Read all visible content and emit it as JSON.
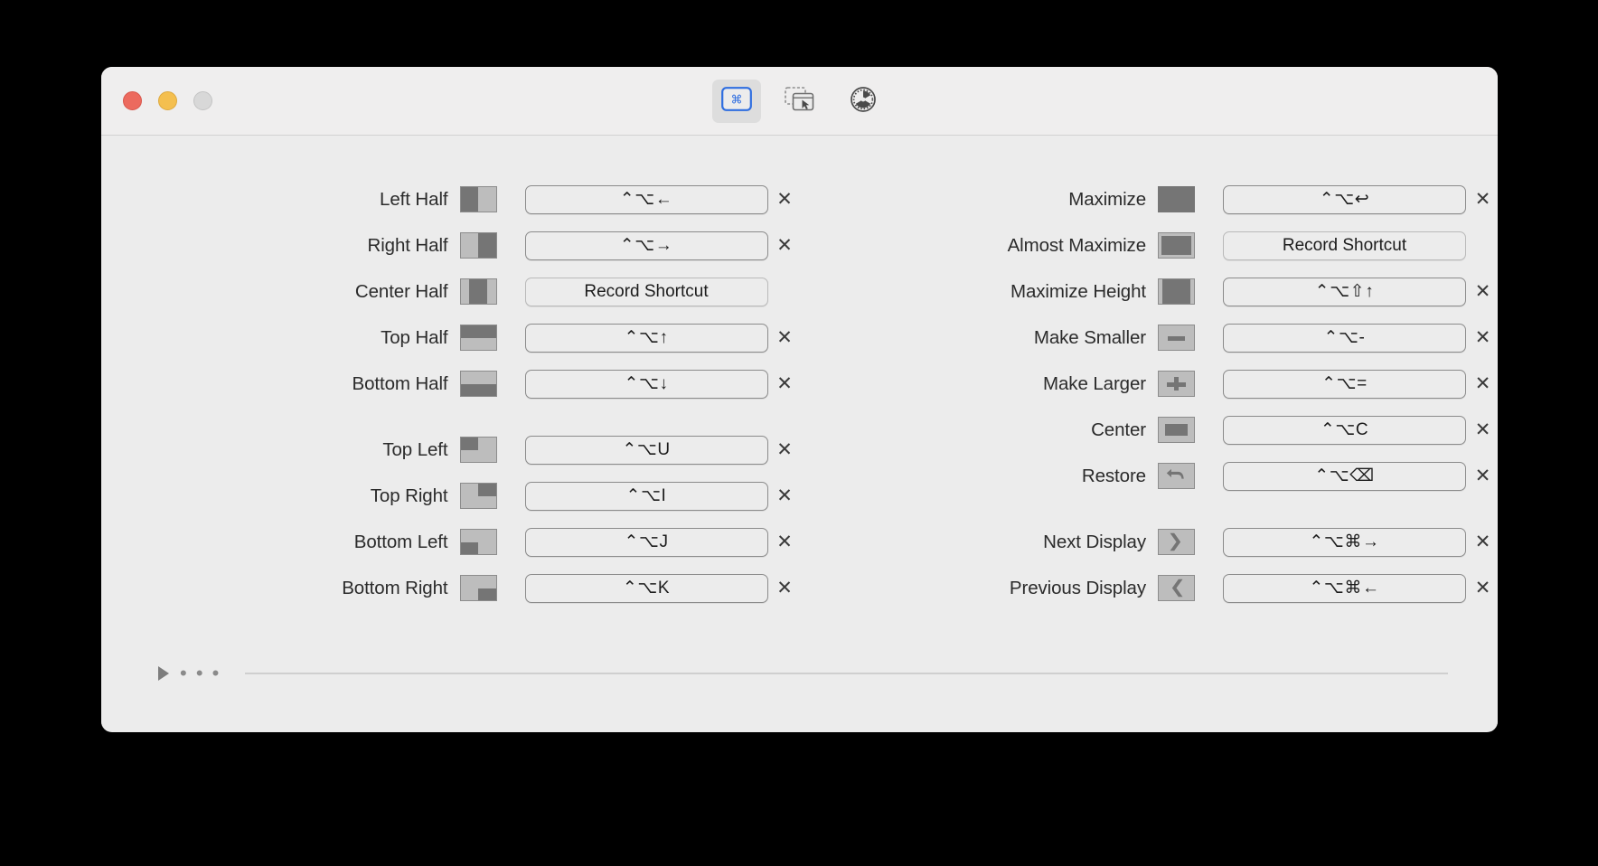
{
  "window": {
    "traffic_lights": [
      {
        "name": "close",
        "color": "#ec6a5e"
      },
      {
        "name": "minimize",
        "color": "#f4bf4f"
      },
      {
        "name": "zoom",
        "color": "#d8d8d8"
      }
    ],
    "accent_color": "#2f6ee0",
    "background": "#ececec"
  },
  "toolbar": {
    "items": [
      {
        "id": "keyboard-shortcuts",
        "icon": "command-window-icon",
        "selected": true
      },
      {
        "id": "snap-areas",
        "icon": "snap-areas-icon",
        "selected": false
      },
      {
        "id": "settings",
        "icon": "gear-icon",
        "selected": false
      }
    ]
  },
  "shortcut_placeholder": "Record Shortcut",
  "clear_glyph": "✕",
  "left_column": [
    {
      "label": "Left Half",
      "icon": "half-left-icon",
      "shortcut": "⌃⌥←",
      "has_shortcut": true,
      "gap_before": false
    },
    {
      "label": "Right Half",
      "icon": "half-right-icon",
      "shortcut": "⌃⌥→",
      "has_shortcut": true,
      "gap_before": false
    },
    {
      "label": "Center Half",
      "icon": "half-center-icon",
      "shortcut": "Record Shortcut",
      "has_shortcut": false,
      "gap_before": false
    },
    {
      "label": "Top Half",
      "icon": "half-top-icon",
      "shortcut": "⌃⌥↑",
      "has_shortcut": true,
      "gap_before": false
    },
    {
      "label": "Bottom Half",
      "icon": "half-bottom-icon",
      "shortcut": "⌃⌥↓",
      "has_shortcut": true,
      "gap_before": false
    },
    {
      "label": "Top Left",
      "icon": "quadrant-top-left-icon",
      "shortcut": "⌃⌥U",
      "has_shortcut": true,
      "gap_before": true
    },
    {
      "label": "Top Right",
      "icon": "quadrant-top-right-icon",
      "shortcut": "⌃⌥I",
      "has_shortcut": true,
      "gap_before": false
    },
    {
      "label": "Bottom Left",
      "icon": "quadrant-bottom-left-icon",
      "shortcut": "⌃⌥J",
      "has_shortcut": true,
      "gap_before": false
    },
    {
      "label": "Bottom Right",
      "icon": "quadrant-bottom-right-icon",
      "shortcut": "⌃⌥K",
      "has_shortcut": true,
      "gap_before": false
    }
  ],
  "right_column": [
    {
      "label": "Maximize",
      "icon": "maximize-icon",
      "shortcut": "⌃⌥↩",
      "has_shortcut": true,
      "gap_before": false
    },
    {
      "label": "Almost Maximize",
      "icon": "almost-maximize-icon",
      "shortcut": "Record Shortcut",
      "has_shortcut": false,
      "gap_before": false
    },
    {
      "label": "Maximize Height",
      "icon": "maximize-height-icon",
      "shortcut": "⌃⌥⇧↑",
      "has_shortcut": true,
      "gap_before": false
    },
    {
      "label": "Make Smaller",
      "icon": "make-smaller-icon",
      "shortcut": "⌃⌥-",
      "has_shortcut": true,
      "gap_before": false
    },
    {
      "label": "Make Larger",
      "icon": "make-larger-icon",
      "shortcut": "⌃⌥=",
      "has_shortcut": true,
      "gap_before": false
    },
    {
      "label": "Center",
      "icon": "center-window-icon",
      "shortcut": "⌃⌥C",
      "has_shortcut": true,
      "gap_before": false
    },
    {
      "label": "Restore",
      "icon": "restore-icon",
      "shortcut": "⌃⌥⌫",
      "has_shortcut": true,
      "gap_before": false
    },
    {
      "label": "Next Display",
      "icon": "next-display-icon",
      "shortcut": "⌃⌥⌘→",
      "has_shortcut": true,
      "gap_before": true
    },
    {
      "label": "Previous Display",
      "icon": "previous-display-icon",
      "shortcut": "⌃⌥⌘←",
      "has_shortcut": true,
      "gap_before": false
    }
  ],
  "footer": {
    "disclosure_icon": "disclosure-triangle-icon",
    "ellipsis": "• • •"
  }
}
